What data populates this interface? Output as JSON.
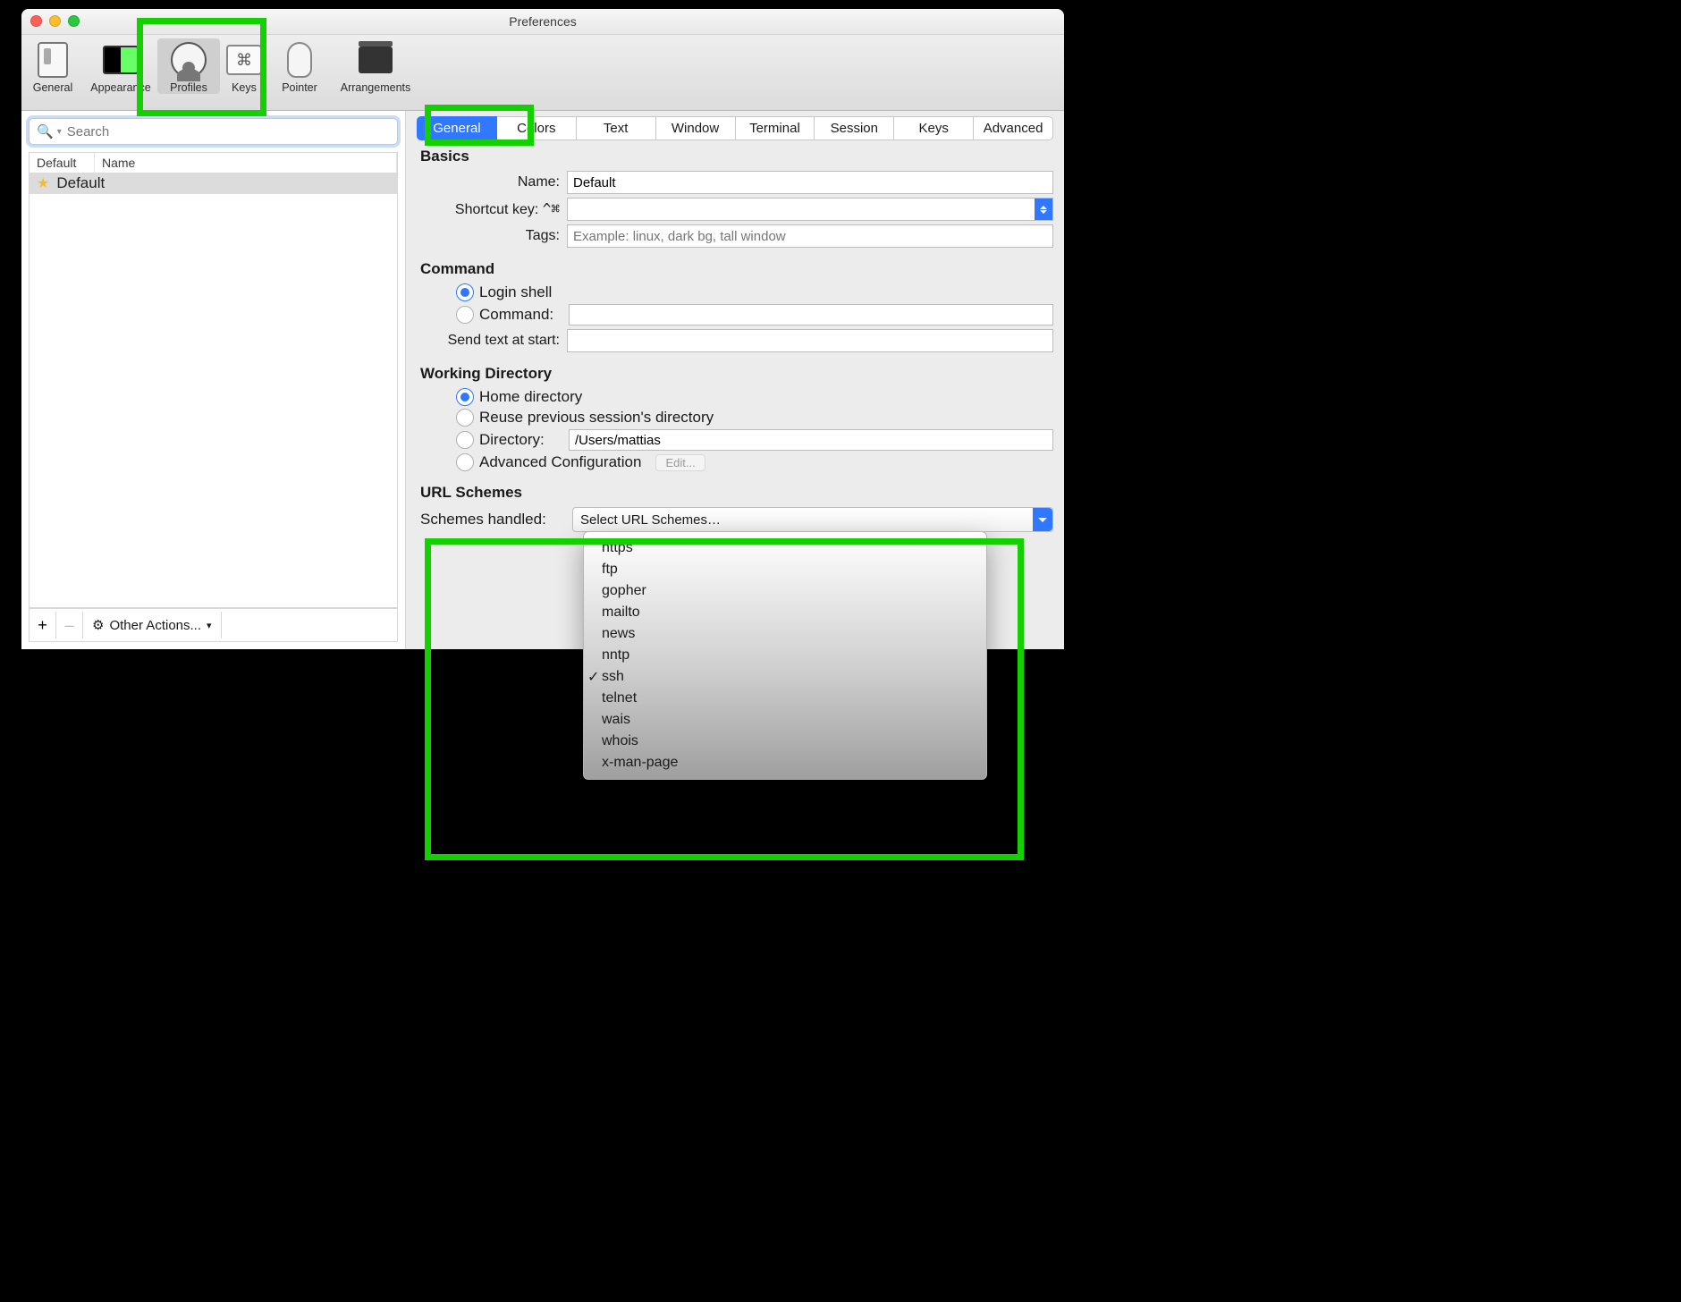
{
  "window": {
    "title": "Preferences"
  },
  "toolbar": {
    "items": [
      {
        "label": "General"
      },
      {
        "label": "Appearance"
      },
      {
        "label": "Profiles"
      },
      {
        "label": "Keys"
      },
      {
        "label": "Pointer"
      },
      {
        "label": "Arrangements"
      }
    ]
  },
  "sidebar": {
    "search_placeholder": "Search",
    "headers": {
      "col1": "Default",
      "col2": "Name"
    },
    "rows": [
      {
        "name": "Default",
        "starred": true,
        "selected": true
      }
    ],
    "footer": {
      "add": "+",
      "remove": "–",
      "other": "Other Actions..."
    }
  },
  "tabs": [
    "General",
    "Colors",
    "Text",
    "Window",
    "Terminal",
    "Session",
    "Keys",
    "Advanced"
  ],
  "active_tab": "General",
  "basics": {
    "title": "Basics",
    "name_label": "Name:",
    "name_value": "Default",
    "shortcut_label": "Shortcut key:",
    "shortcut_prefix": "^⌘",
    "tags_label": "Tags:",
    "tags_placeholder": "Example: linux, dark bg, tall window"
  },
  "command": {
    "title": "Command",
    "login_shell": "Login shell",
    "command_label": "Command:",
    "command_value": "",
    "send_label": "Send text at start:",
    "send_value": ""
  },
  "working_dir": {
    "title": "Working Directory",
    "home": "Home directory",
    "reuse": "Reuse previous session's directory",
    "dir_label": "Directory:",
    "dir_value": "/Users/mattias",
    "adv": "Advanced Configuration",
    "edit": "Edit..."
  },
  "url_schemes": {
    "title": "URL Schemes",
    "label": "Schemes handled:",
    "placeholder": "Select URL Schemes…",
    "options": [
      {
        "label": "https",
        "checked": false
      },
      {
        "label": "ftp",
        "checked": false
      },
      {
        "label": "gopher",
        "checked": false
      },
      {
        "label": "mailto",
        "checked": false
      },
      {
        "label": "news",
        "checked": false
      },
      {
        "label": "nntp",
        "checked": false
      },
      {
        "label": "ssh",
        "checked": true
      },
      {
        "label": "telnet",
        "checked": false
      },
      {
        "label": "wais",
        "checked": false
      },
      {
        "label": "whois",
        "checked": false
      },
      {
        "label": "x-man-page",
        "checked": false
      }
    ]
  }
}
